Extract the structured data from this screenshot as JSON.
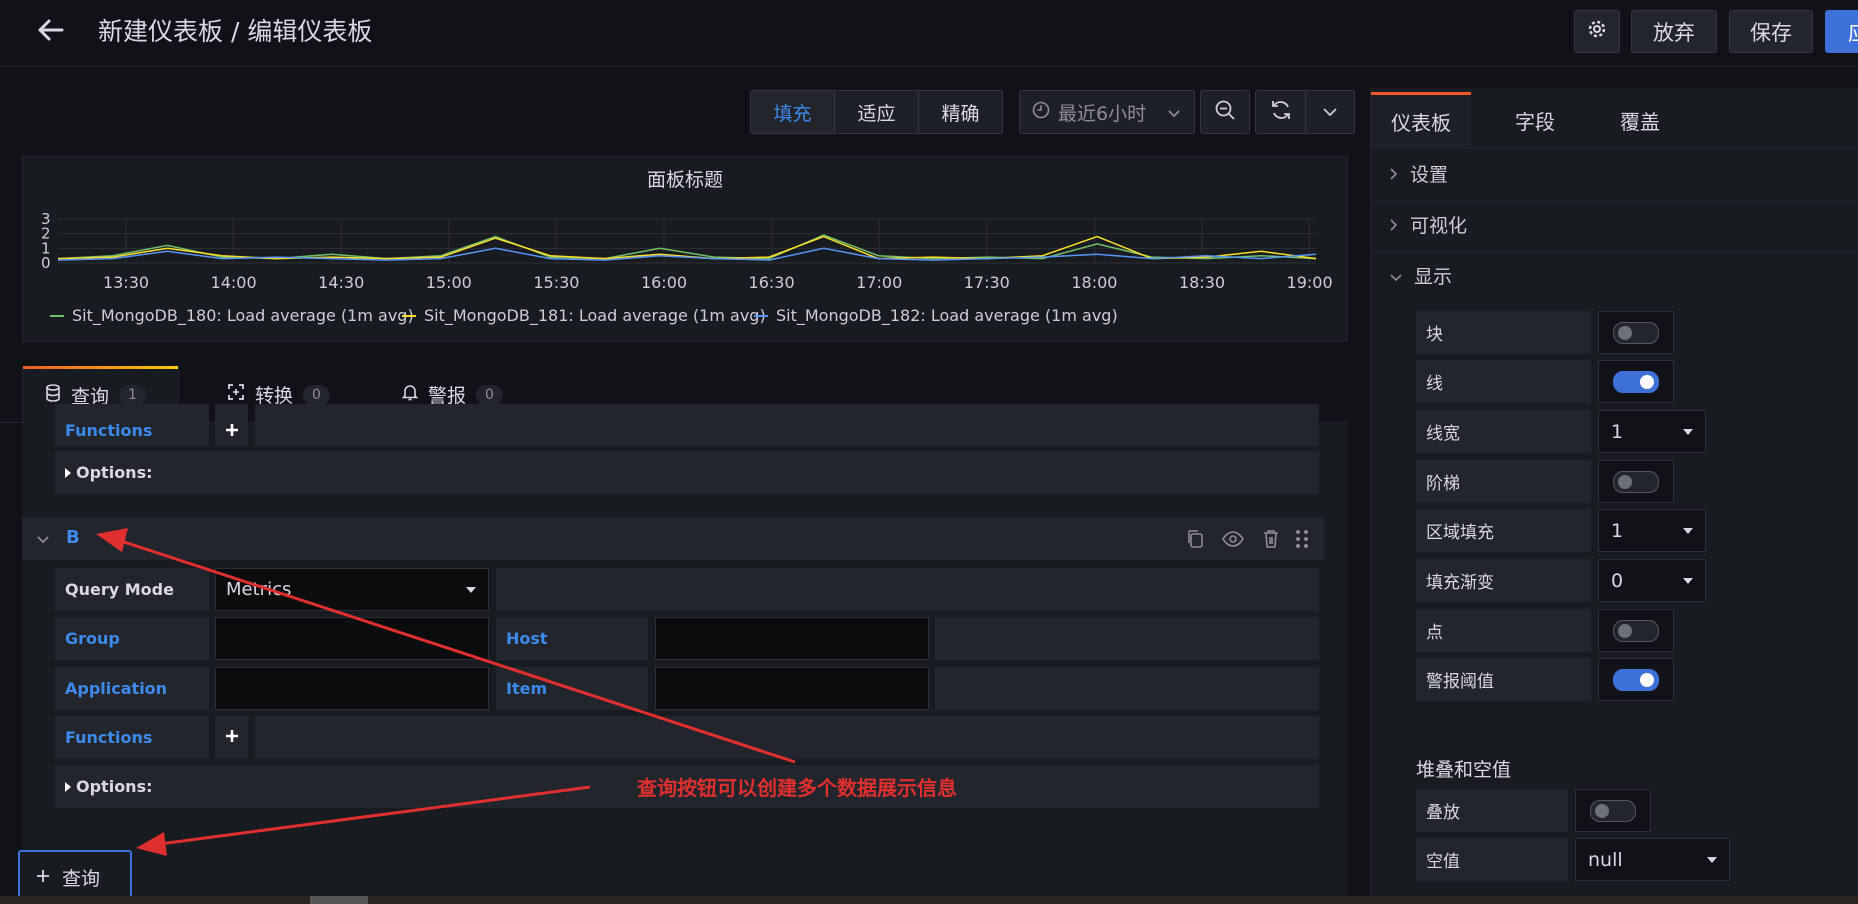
{
  "header": {
    "title": "新建仪表板 / 编辑仪表板",
    "discard_label": "放弃",
    "save_label": "保存",
    "apply_label": "应"
  },
  "toolbar": {
    "view_modes": [
      "填充",
      "适应",
      "精确"
    ],
    "active_view_mode": "填充",
    "time_range": "最近6小时"
  },
  "panel": {
    "title": "面板标题"
  },
  "chart_data": {
    "type": "line",
    "title": "面板标题",
    "x": [
      "13:30",
      "14:00",
      "14:30",
      "15:00",
      "15:30",
      "16:00",
      "16:30",
      "17:00",
      "17:30",
      "18:00",
      "18:30",
      "19:00"
    ],
    "y_ticks": [
      "0",
      "1",
      "2",
      "3"
    ],
    "ylim": [
      0,
      3
    ],
    "grid": true,
    "legend_position": "bottom",
    "series": [
      {
        "name": "Sit_MongoDB_180: Load average (1m avg)",
        "color": "#73bf69",
        "values": [
          0.3,
          0.5,
          1.2,
          0.4,
          0.3,
          0.6,
          0.3,
          0.5,
          1.8,
          0.4,
          0.3,
          1.0,
          0.4,
          0.3,
          1.9,
          0.5,
          0.3,
          0.4,
          0.3,
          1.3,
          0.4,
          0.3,
          0.5,
          0.3
        ]
      },
      {
        "name": "Sit_MongoDB_181: Load average (1m avg)",
        "color": "#fade2a",
        "values": [
          0.3,
          0.4,
          1.0,
          0.5,
          0.3,
          0.4,
          0.3,
          0.4,
          1.7,
          0.5,
          0.3,
          0.6,
          0.3,
          0.4,
          1.8,
          0.3,
          0.4,
          0.3,
          0.5,
          1.8,
          0.3,
          0.4,
          0.8,
          0.3
        ]
      },
      {
        "name": "Sit_MongoDB_182: Load average (1m avg)",
        "color": "#5794f2",
        "values": [
          0.2,
          0.3,
          0.8,
          0.3,
          0.4,
          0.3,
          0.2,
          0.3,
          1.0,
          0.3,
          0.2,
          0.5,
          0.3,
          0.2,
          1.0,
          0.3,
          0.2,
          0.3,
          0.4,
          0.6,
          0.3,
          0.5,
          0.3,
          0.6
        ]
      }
    ]
  },
  "tabs": [
    {
      "label": "查询",
      "count": "1"
    },
    {
      "label": "转换",
      "count": "0"
    },
    {
      "label": "警报",
      "count": "0"
    }
  ],
  "query_editor": {
    "functions_label": "Functions",
    "options_label": "Options:",
    "query_b": {
      "name": "B",
      "query_mode_label": "Query Mode",
      "query_mode_value": "Metrics",
      "group_label": "Group",
      "host_label": "Host",
      "application_label": "Application",
      "item_label": "Item",
      "functions_label": "Functions",
      "options_label": "Options:"
    },
    "add_query_label": "查询"
  },
  "annotation": {
    "text": "查询按钮可以创建多个数据展示信息",
    "color": "#e02f2f"
  },
  "options": {
    "tabs": [
      "仪表板",
      "字段",
      "覆盖"
    ],
    "sections": {
      "settings": "设置",
      "visualization": "可视化",
      "display": "显示",
      "stacking": "堆叠和空值"
    },
    "display_rows": [
      {
        "label": "块",
        "type": "switch",
        "on": false
      },
      {
        "label": "线",
        "type": "switch",
        "on": true
      },
      {
        "label": "线宽",
        "type": "select",
        "value": "1"
      },
      {
        "label": "阶梯",
        "type": "switch",
        "on": false
      },
      {
        "label": "区域填充",
        "type": "select",
        "value": "1"
      },
      {
        "label": "填充渐变",
        "type": "select",
        "value": "0"
      },
      {
        "label": "点",
        "type": "switch",
        "on": false
      },
      {
        "label": "警报阈值",
        "type": "switch",
        "on": true
      }
    ],
    "stack_label": "叠放",
    "stack_on": false,
    "null_label": "空值",
    "null_value": "null"
  },
  "colors": {
    "accent_blue": "#3d71d9",
    "link_blue": "#3d8aed",
    "background": "#111217"
  }
}
